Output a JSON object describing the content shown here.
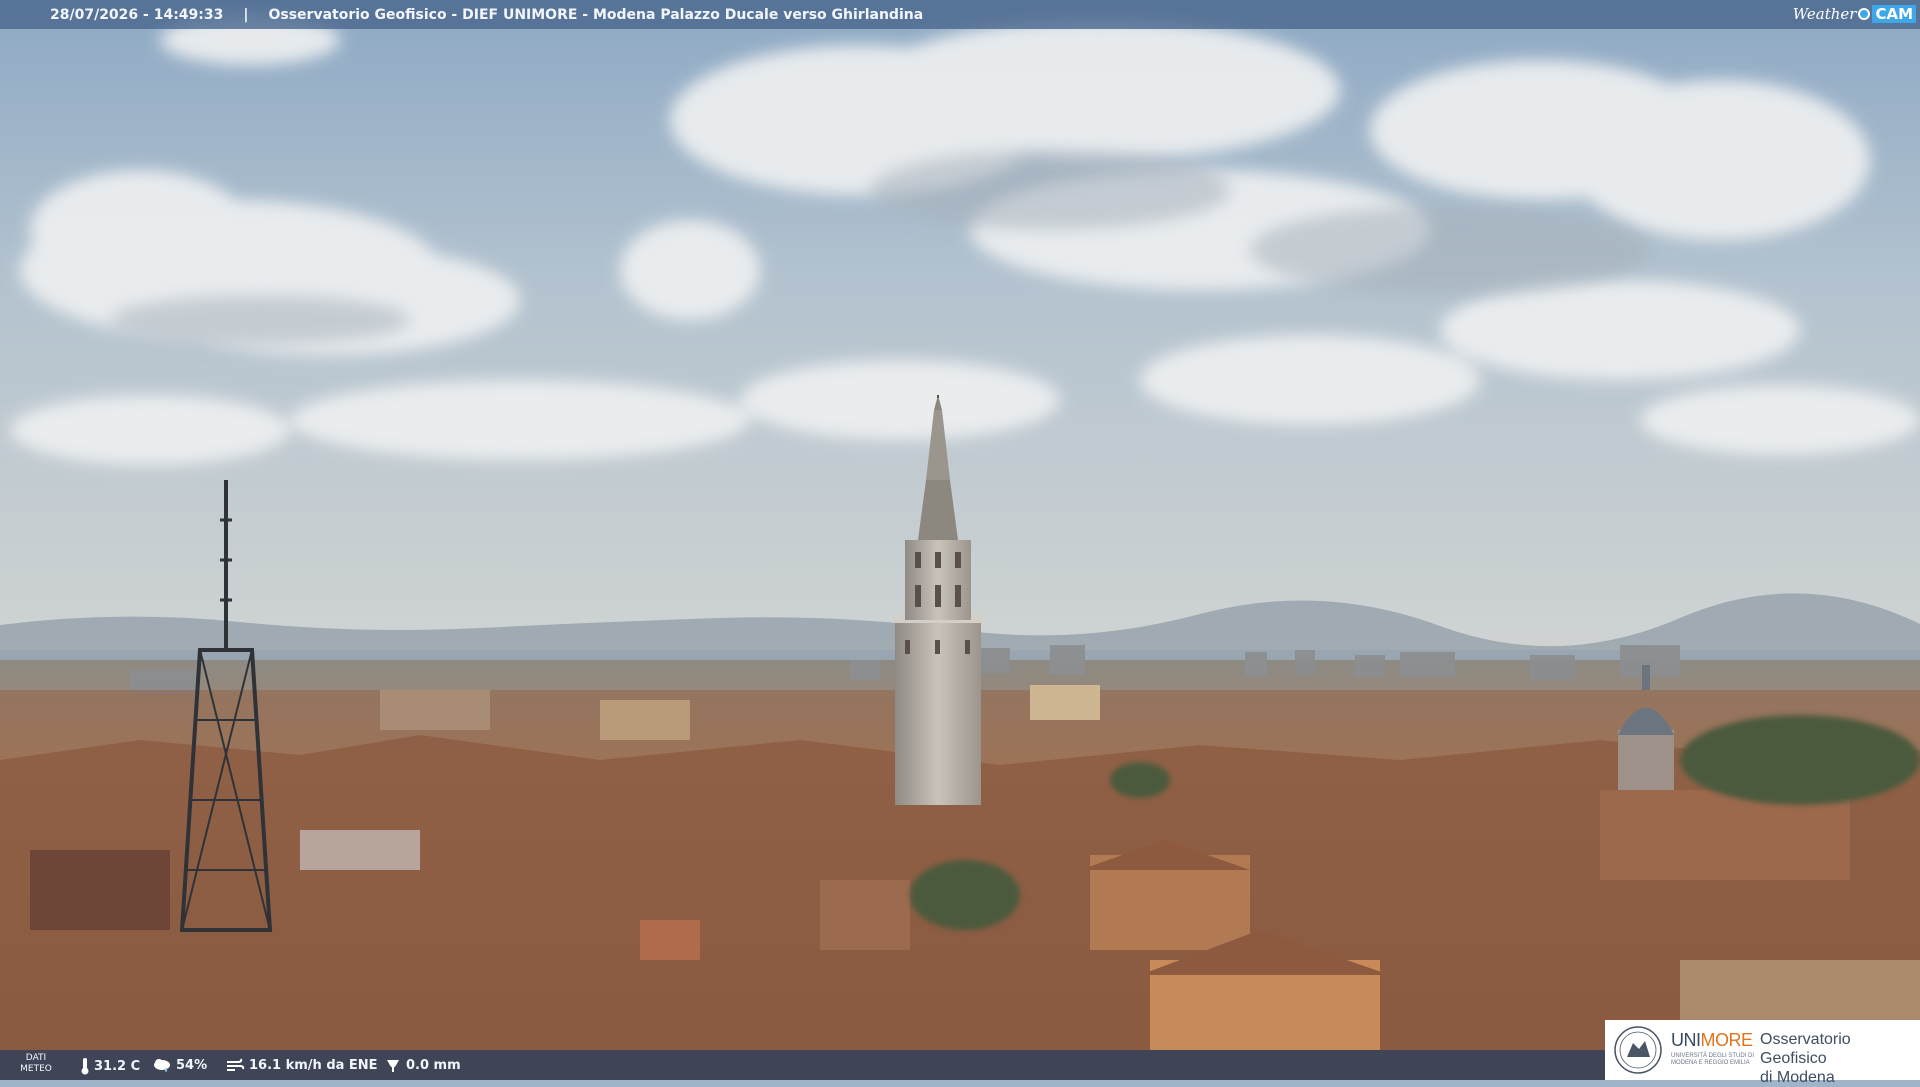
{
  "webcam": {
    "timestamp": "28/07/2026 - 14:49:33",
    "separator": "|",
    "caption": "Osservatorio Geofisico - DIEF UNIMORE - Modena Palazzo Ducale verso Ghirlandina"
  },
  "weathercam_logo": {
    "word1": "Weather",
    "word2": "CAM"
  },
  "meteo": {
    "label_line1": "DATI",
    "label_line2": "METEO",
    "temperature": "31.2 C",
    "humidity": "54%",
    "wind": "16.1 km/h da ENE",
    "rain": "0.0 mm"
  },
  "institution": {
    "name_part1": "UNI",
    "name_part2": "MORE",
    "subtitle": "UNIVERSITÀ DEGLI STUDI DI MODENA E REGGIO EMILIA",
    "observatory_line1": "Osservatorio Geofisico",
    "observatory_line2": "di Modena"
  },
  "icons": {
    "temperature": "thermometer-icon",
    "humidity": "cloud-drop-icon",
    "wind": "wind-icon",
    "rain": "rain-gauge-icon"
  },
  "colors": {
    "sky_top": "#8fa9c3",
    "sky_bottom": "#c6cdd1",
    "roof": "#9a6b4f",
    "tower": "#b9b3aa",
    "accent_orange": "#e0751e"
  }
}
